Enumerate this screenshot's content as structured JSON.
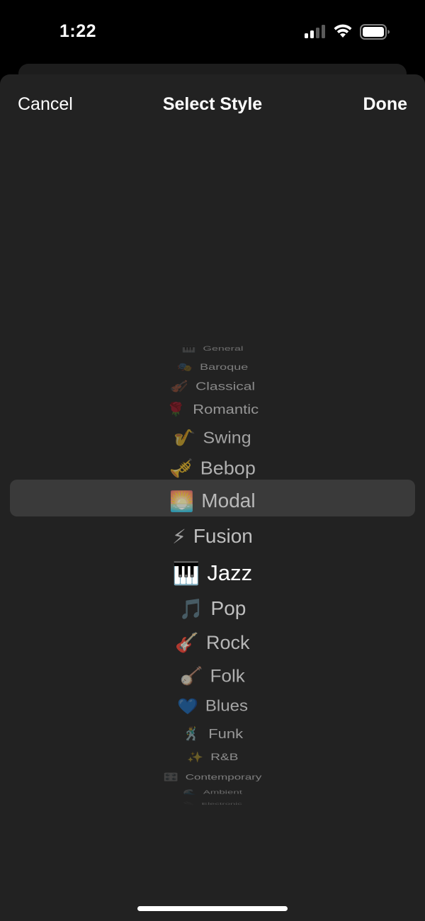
{
  "status_bar": {
    "time": "1:22",
    "signal_icon": "cellular-signal-icon",
    "wifi_icon": "wifi-icon",
    "battery_icon": "battery-icon"
  },
  "nav": {
    "cancel_label": "Cancel",
    "title": "Select Style",
    "done_label": "Done"
  },
  "picker": {
    "selected": "Jazz",
    "items": [
      {
        "emoji": "🎹",
        "label": "General"
      },
      {
        "emoji": "🎭",
        "label": "Baroque"
      },
      {
        "emoji": "🎻",
        "label": "Classical"
      },
      {
        "emoji": "🌹",
        "label": "Romantic"
      },
      {
        "emoji": "🎷",
        "label": "Swing"
      },
      {
        "emoji": "🎺",
        "label": "Bebop"
      },
      {
        "emoji": "🌅",
        "label": "Modal"
      },
      {
        "emoji": "⚡",
        "label": "Fusion"
      },
      {
        "emoji": "🎹",
        "label": "Jazz"
      },
      {
        "emoji": "🎵",
        "label": "Pop"
      },
      {
        "emoji": "🎸",
        "label": "Rock"
      },
      {
        "emoji": "🪕",
        "label": "Folk"
      },
      {
        "emoji": "💙",
        "label": "Blues"
      },
      {
        "emoji": "🕺",
        "label": "Funk"
      },
      {
        "emoji": "✨",
        "label": "R&B"
      },
      {
        "emoji": "🎛️",
        "label": "Contemporary"
      },
      {
        "emoji": "🌊",
        "label": "Ambient"
      },
      {
        "emoji": "🔌",
        "label": "Electronic"
      }
    ]
  },
  "colors": {
    "background": "#000000",
    "sheet": "#222222",
    "highlight": "#3a3a3a",
    "text": "#ffffff"
  }
}
